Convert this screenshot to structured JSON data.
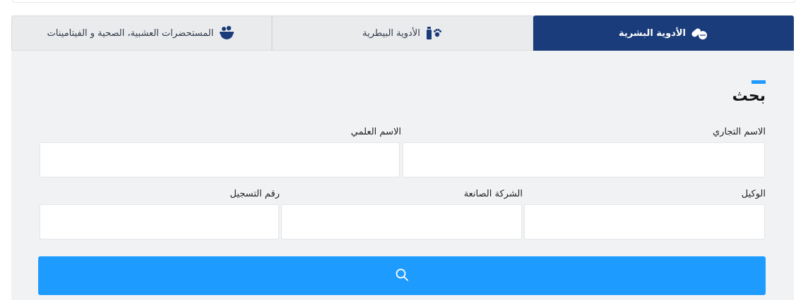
{
  "tabs": [
    {
      "label": "الأدوية البشرية",
      "icon": "pills-icon",
      "active": true
    },
    {
      "label": "الأدوية البيطرية",
      "icon": "paw-bottle-icon",
      "active": false
    },
    {
      "label": "المستحضرات العشبية، الصحية و الفيتامينات",
      "icon": "herbal-bowl-icon",
      "active": false
    }
  ],
  "search": {
    "title": "بحث",
    "fields": {
      "trade_name": {
        "label": "الاسم التجاري",
        "value": ""
      },
      "scientific_name": {
        "label": "الاسم العلمي",
        "value": ""
      },
      "agent": {
        "label": "الوكيل",
        "value": ""
      },
      "manufacturer": {
        "label": "الشركة الصانعة",
        "value": ""
      },
      "registration_number": {
        "label": "رقم التسجيل",
        "value": ""
      }
    },
    "button_icon": "search-icon"
  },
  "colors": {
    "active_tab": "#1b3c7a",
    "accent": "#1f98ff",
    "button": "#1e9bff",
    "panel": "#f1f2f4"
  }
}
